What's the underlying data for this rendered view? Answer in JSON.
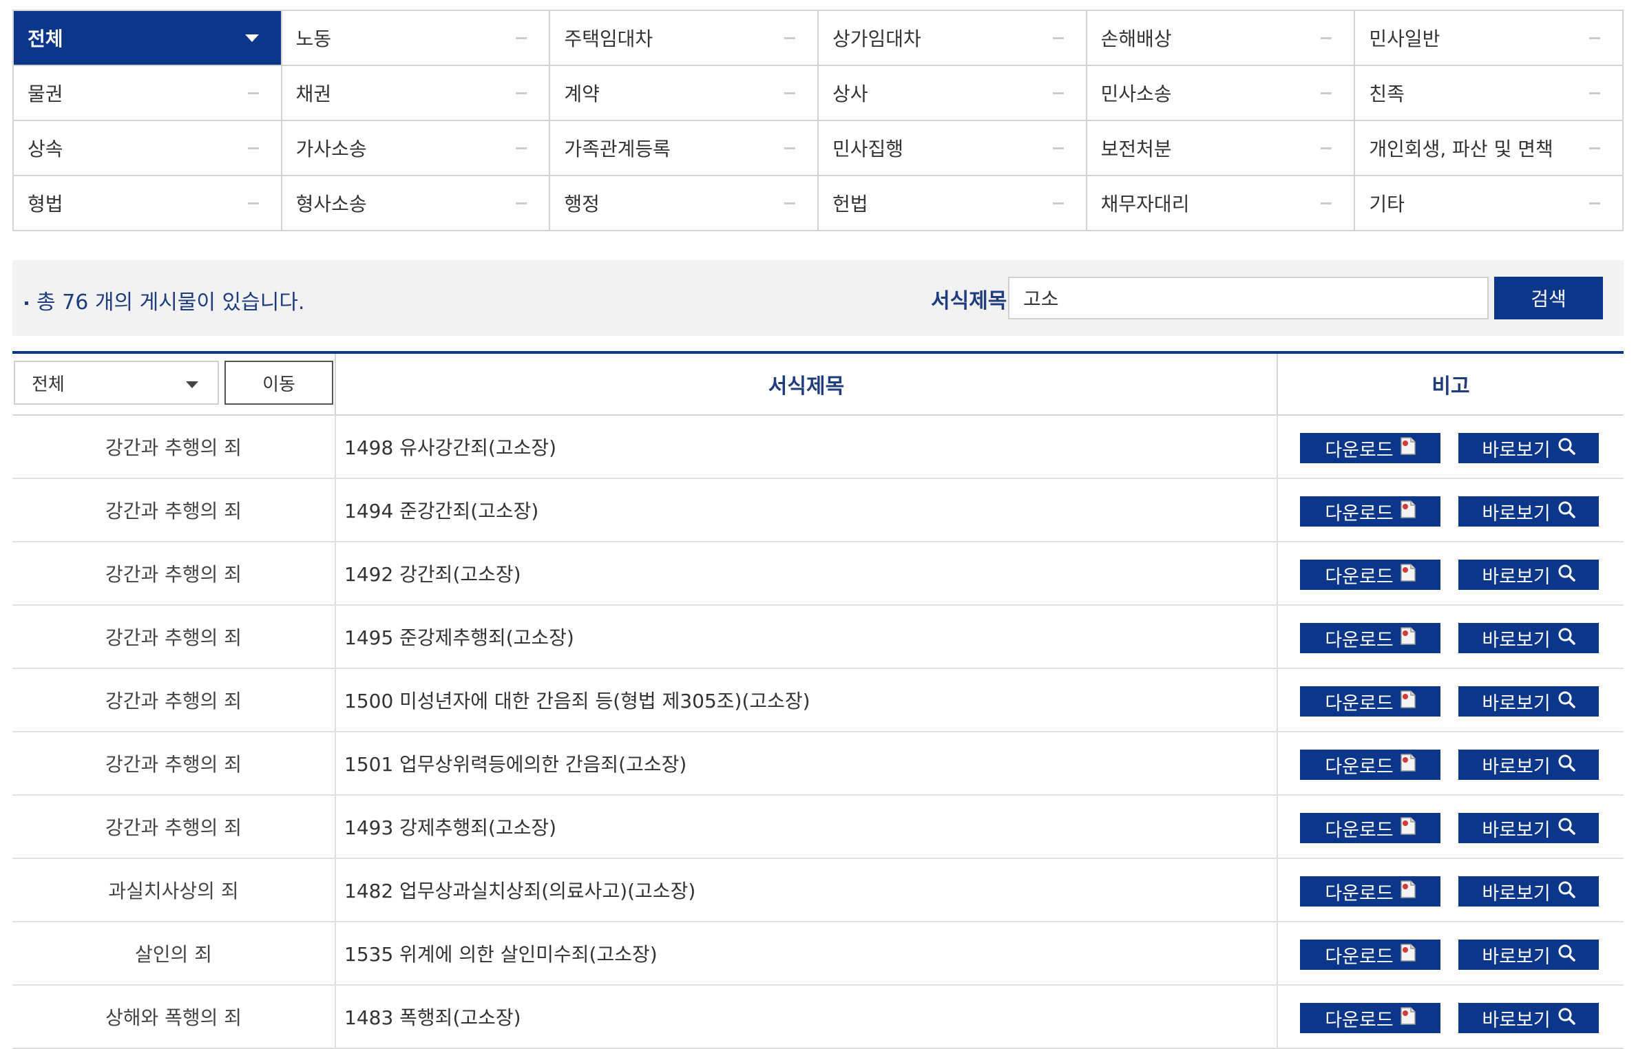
{
  "categories": [
    {
      "label": "전체",
      "active": true
    },
    {
      "label": "노동"
    },
    {
      "label": "주택임대차"
    },
    {
      "label": "상가임대차"
    },
    {
      "label": "손해배상"
    },
    {
      "label": "민사일반"
    },
    {
      "label": "물권"
    },
    {
      "label": "채권"
    },
    {
      "label": "계약"
    },
    {
      "label": "상사"
    },
    {
      "label": "민사소송"
    },
    {
      "label": "친족"
    },
    {
      "label": "상속"
    },
    {
      "label": "가사소송"
    },
    {
      "label": "가족관계등록"
    },
    {
      "label": "민사집행"
    },
    {
      "label": "보전처분"
    },
    {
      "label": "개인회생, 파산 및 면책"
    },
    {
      "label": "형법"
    },
    {
      "label": "형사소송"
    },
    {
      "label": "행정"
    },
    {
      "label": "헌법"
    },
    {
      "label": "채무자대리"
    },
    {
      "label": "기타"
    }
  ],
  "search": {
    "total_prefix": "총 ",
    "total_count": "76",
    "total_suffix": " 개의 게시물이 있습니다.",
    "label": "서식제목",
    "value": "고소",
    "button": "검색"
  },
  "table": {
    "filter_value": "전체",
    "move_button": "이동",
    "col_title": "서식제목",
    "col_note": "비고",
    "download_label": "다운로드",
    "view_label": "바로보기",
    "rows": [
      {
        "category": "강간과 추행의 죄",
        "title": "1498 유사강간죄(고소장)"
      },
      {
        "category": "강간과 추행의 죄",
        "title": "1494 준강간죄(고소장)"
      },
      {
        "category": "강간과 추행의 죄",
        "title": "1492 강간죄(고소장)"
      },
      {
        "category": "강간과 추행의 죄",
        "title": "1495 준강제추행죄(고소장)"
      },
      {
        "category": "강간과 추행의 죄",
        "title": "1500 미성년자에 대한 간음죄 등(형법 제305조)(고소장)"
      },
      {
        "category": "강간과 추행의 죄",
        "title": "1501 업무상위력등에의한 간음죄(고소장)"
      },
      {
        "category": "강간과 추행의 죄",
        "title": "1493 강제추행죄(고소장)"
      },
      {
        "category": "과실치사상의 죄",
        "title": "1482 업무상과실치상죄(의료사고)(고소장)"
      },
      {
        "category": "살인의 죄",
        "title": "1535 위계에 의한 살인미수죄(고소장)"
      },
      {
        "category": "상해와 폭행의 죄",
        "title": "1483 폭행죄(고소장)"
      }
    ]
  },
  "icons": {
    "dropdown": "caret-down-icon",
    "download": "file-icon",
    "view": "magnifier-icon"
  },
  "colors": {
    "primary": "#0c3689",
    "text_blue": "#1f3c7c"
  }
}
